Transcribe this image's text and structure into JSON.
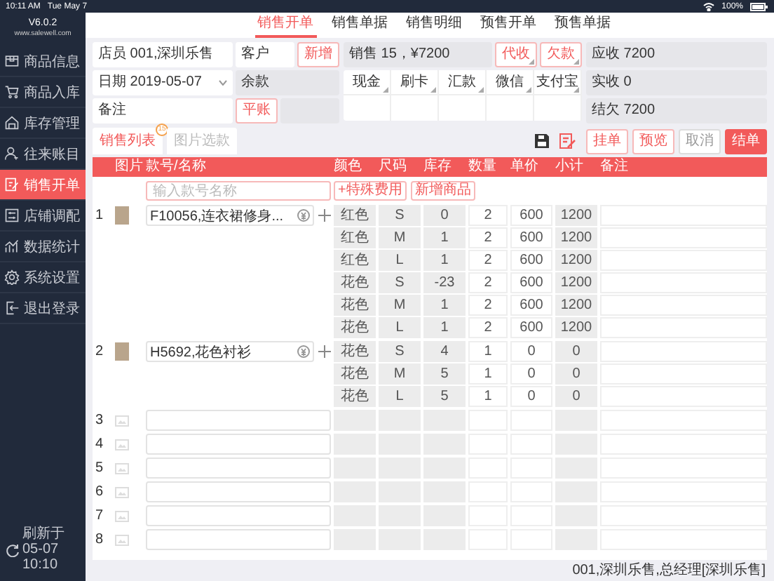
{
  "status_bar": {
    "time": "10:11 AM",
    "date": "Tue May 7",
    "battery": "100%"
  },
  "sidebar": {
    "version": "V6.0.2",
    "website": "www.salewell.com",
    "items": [
      {
        "label": "商品信息",
        "selected": false
      },
      {
        "label": "商品入库",
        "selected": false
      },
      {
        "label": "库存管理",
        "selected": false
      },
      {
        "label": "往来账目",
        "selected": false
      },
      {
        "label": "销售开单",
        "selected": true
      },
      {
        "label": "店铺调配",
        "selected": false
      },
      {
        "label": "数据统计",
        "selected": false
      },
      {
        "label": "系统设置",
        "selected": false
      },
      {
        "label": "退出登录",
        "selected": false
      }
    ],
    "refresh": "刷新于05-07 10:10"
  },
  "top_tabs": [
    {
      "label": "销售开单",
      "selected": true
    },
    {
      "label": "销售单据",
      "selected": false
    },
    {
      "label": "销售明细",
      "selected": false
    },
    {
      "label": "预售开单",
      "selected": false
    },
    {
      "label": "预售单据",
      "selected": false
    }
  ],
  "order_form": {
    "clerk": {
      "label": "店员",
      "value": "001,深圳乐售",
      "readonly": false
    },
    "customer": {
      "label": "客户",
      "readonly": false
    },
    "add_button": "新增",
    "date": {
      "label": "日期",
      "value": "2019-05-07",
      "readonly": false
    },
    "balance": {
      "label": "余款",
      "readonly": true
    },
    "note": {
      "label": "备注",
      "readonly": false
    },
    "settle_button": "平账"
  },
  "summary": {
    "sales": "销售 15，¥7200",
    "collect_button": "代收",
    "debt_button": "欠款",
    "payments": [
      {
        "label": "现金"
      },
      {
        "label": "刷卡"
      },
      {
        "label": "汇款"
      },
      {
        "label": "微信"
      },
      {
        "label": "支付宝"
      }
    ]
  },
  "totals": [
    {
      "label": "应收",
      "value": "7200",
      "readonly": true
    },
    {
      "label": "实收",
      "value": "0",
      "readonly": true
    },
    {
      "label": "结欠",
      "value": "7200",
      "readonly": true
    }
  ],
  "list_tabs": [
    {
      "label": "销售列表",
      "selected": true,
      "badge": "15"
    },
    {
      "label": "图片选款",
      "selected": false
    }
  ],
  "actions": [
    {
      "label": "挂单",
      "kind": "outline"
    },
    {
      "label": "预览",
      "kind": "outline"
    },
    {
      "label": "取消",
      "kind": "plain"
    },
    {
      "label": "结单",
      "kind": "primary"
    }
  ],
  "table": {
    "columns": [
      "图片",
      "款号/名称",
      "颜色",
      "尺码",
      "库存",
      "数量",
      "单价",
      "小计",
      "备注"
    ],
    "search_placeholder": "输入款号名称",
    "special_fee_button": "+特殊费用",
    "new_product_button": "新增商品",
    "rows": [
      {
        "kind": "product",
        "number": "1",
        "name": "F10056,连衣裙修身...",
        "variants": [
          {
            "color_name": "红色",
            "size": "S",
            "stock": "0",
            "qty": "2",
            "price": "600",
            "subtotal": "1200"
          },
          {
            "color_name": "红色",
            "size": "M",
            "stock": "1",
            "qty": "2",
            "price": "600",
            "subtotal": "1200"
          },
          {
            "color_name": "红色",
            "size": "L",
            "stock": "1",
            "qty": "2",
            "price": "600",
            "subtotal": "1200"
          },
          {
            "color_name": "花色",
            "size": "S",
            "stock": "-23",
            "qty": "2",
            "price": "600",
            "subtotal": "1200"
          },
          {
            "color_name": "花色",
            "size": "M",
            "stock": "1",
            "qty": "2",
            "price": "600",
            "subtotal": "1200"
          },
          {
            "color_name": "花色",
            "size": "L",
            "stock": "1",
            "qty": "2",
            "price": "600",
            "subtotal": "1200"
          }
        ]
      },
      {
        "kind": "product",
        "number": "2",
        "name": "H5692,花色衬衫",
        "variants": [
          {
            "color_name": "花色",
            "size": "S",
            "stock": "4",
            "qty": "1",
            "price": "0",
            "subtotal": "0"
          },
          {
            "color_name": "花色",
            "size": "M",
            "stock": "5",
            "qty": "1",
            "price": "0",
            "subtotal": "0"
          },
          {
            "color_name": "花色",
            "size": "L",
            "stock": "5",
            "qty": "1",
            "price": "0",
            "subtotal": "0"
          }
        ]
      },
      {
        "kind": "empty",
        "number": "3"
      },
      {
        "kind": "empty",
        "number": "4"
      },
      {
        "kind": "empty",
        "number": "5"
      },
      {
        "kind": "empty",
        "number": "6"
      },
      {
        "kind": "empty",
        "number": "7"
      },
      {
        "kind": "empty",
        "number": "8"
      }
    ]
  },
  "footer": "001,深圳乐售,总经理[深圳乐售]"
}
